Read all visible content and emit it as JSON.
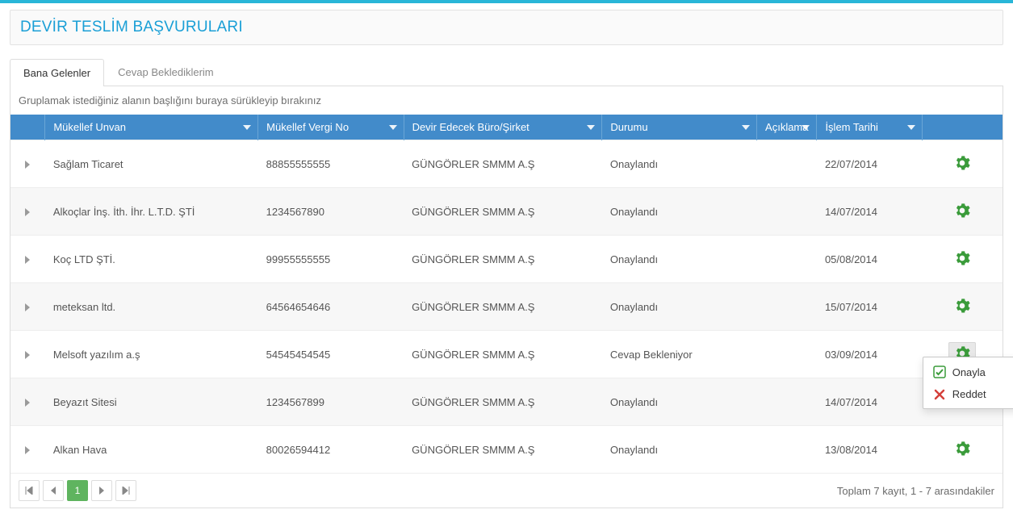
{
  "title": "DEVİR TESLİM BAŞVURULARI",
  "tabs": [
    {
      "label": "Bana Gelenler",
      "active": true
    },
    {
      "label": "Cevap Beklediklerim",
      "active": false
    }
  ],
  "group_bar_text": "Gruplamak istediğiniz alanın başlığını buraya sürükleyip bırakınız",
  "columns": {
    "unvan": "Mükellef Unvan",
    "vergi": "Mükellef Vergi No",
    "buro": "Devir Edecek Büro/Şirket",
    "durum": "Durumu",
    "aciklama": "Açıklama",
    "tarih": "İşlem Tarihi"
  },
  "rows": [
    {
      "unvan": "Sağlam Ticaret",
      "vergi": "88855555555",
      "buro": "GÜNGÖRLER SMMM A.Ş",
      "durum": "Onaylandı",
      "aciklama": "",
      "tarih": "22/07/2014",
      "menu_open": false
    },
    {
      "unvan": "Alkoçlar İnş. İth. İhr. L.T.D. ŞTİ",
      "vergi": "1234567890",
      "buro": "GÜNGÖRLER SMMM A.Ş",
      "durum": "Onaylandı",
      "aciklama": "",
      "tarih": "14/07/2014",
      "menu_open": false
    },
    {
      "unvan": "Koç LTD ŞTİ.",
      "vergi": "99955555555",
      "buro": "GÜNGÖRLER SMMM A.Ş",
      "durum": "Onaylandı",
      "aciklama": "",
      "tarih": "05/08/2014",
      "menu_open": false
    },
    {
      "unvan": "meteksan ltd.",
      "vergi": "64564654646",
      "buro": "GÜNGÖRLER SMMM A.Ş",
      "durum": "Onaylandı",
      "aciklama": "",
      "tarih": "15/07/2014",
      "menu_open": false
    },
    {
      "unvan": "Melsoft yazılım a.ş",
      "vergi": "54545454545",
      "buro": "GÜNGÖRLER SMMM A.Ş",
      "durum": "Cevap Bekleniyor",
      "aciklama": "",
      "tarih": "03/09/2014",
      "menu_open": true
    },
    {
      "unvan": "Beyazıt Sitesi",
      "vergi": "1234567899",
      "buro": "GÜNGÖRLER SMMM A.Ş",
      "durum": "Onaylandı",
      "aciklama": "",
      "tarih": "14/07/2014",
      "menu_open": false
    },
    {
      "unvan": "Alkan Hava",
      "vergi": "80026594412",
      "buro": "GÜNGÖRLER SMMM A.Ş",
      "durum": "Onaylandı",
      "aciklama": "",
      "tarih": "13/08/2014",
      "menu_open": false
    }
  ],
  "context_menu": {
    "approve": "Onayla",
    "reject": "Reddet"
  },
  "pager": {
    "first": "|<",
    "prev": "<",
    "current": "1",
    "next": ">",
    "last": ">|"
  },
  "footer_info": "Toplam 7 kayıt, 1 - 7 arasındakiler"
}
